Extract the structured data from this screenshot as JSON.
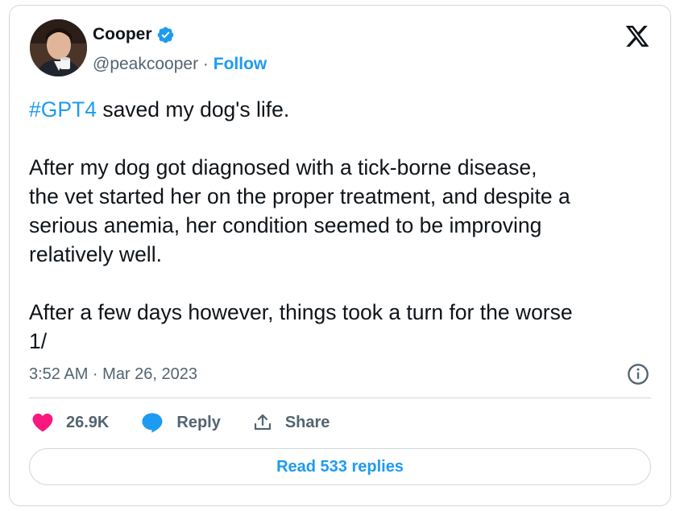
{
  "author": {
    "name": "Cooper",
    "handle": "@peakcooper",
    "separator": " · ",
    "follow_label": "Follow",
    "avatar_icon": "user-avatar",
    "verified_icon": "verified-badge-icon"
  },
  "platform_icon": "x-logo-icon",
  "tweet": {
    "hashtag": "#GPT4",
    "first_line_rest": " saved my dog's life.",
    "body": "\n\nAfter my dog got diagnosed with a tick-borne disease,\nthe vet started her on the proper treatment, and despite a\nserious anemia, her condition seemed to be improving\nrelatively well.\n\nAfter a few days however, things took a turn for the worse\n1/"
  },
  "timestamp": "3:52 AM · Mar 26, 2023",
  "actions": {
    "likes_count": "26.9K",
    "reply_label": "Reply",
    "share_label": "Share"
  },
  "read_replies_label": "Read 533 replies",
  "colors": {
    "accent": "#1d9bf0",
    "like": "#f91880",
    "muted": "#536471",
    "text": "#0f1419",
    "border": "#cfd9de"
  }
}
